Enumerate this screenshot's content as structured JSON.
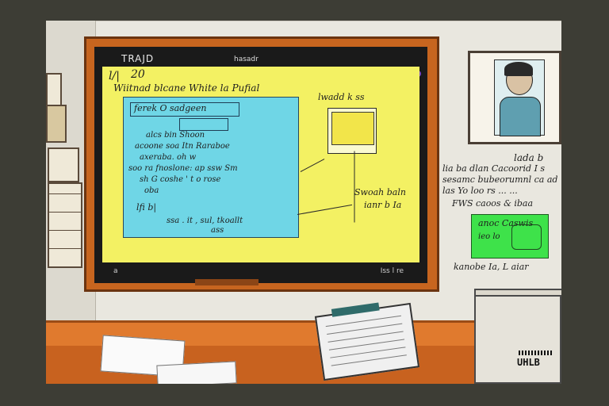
{
  "monitor": {
    "brand": "TRAJD",
    "brand_sub": "hasadr",
    "screen_heading": "Wiitnad  blcane    White  la  Pufial",
    "top_left_mark": "l/|",
    "top_left_mark2": "20",
    "blue_panel": {
      "title": "ferek  O  sadgeen",
      "lines": [
        "alcs   bin  Shoon",
        "acoone   soa  Itn  Raraboe",
        "axeraba.  oh  w",
        "soo  ra fnoslone:  ap  ssw  Sm",
        "sh  G   coshe  '  t  o  rose",
        "oba",
        "lfi b|",
        "ssa  .  it  ,  sul,  tkoallt",
        "ass"
      ]
    },
    "card_mini_caption": "lwadd  k  ss",
    "right_text": [
      "Swoah  baln",
      "ianr  b  Ia"
    ],
    "status_right": "Iss  l  re",
    "status_left": "a"
  },
  "right_wall": {
    "text_lines": [
      "lada  b",
      "lia  ba  dlan  Cacoorid  I  s",
      "sesamc  bubeorumnl  ca  ad",
      "las  Yo  loo  rs  ...  ..."
    ],
    "note_label": "FWS  caoos  &  ibaa",
    "green_note_title": "anoc  Caswis",
    "green_note_sub": "ieo  lo",
    "under_note": "kanobe  Ia,  L  aiar"
  },
  "logo": {
    "text": "UHLB"
  },
  "colors": {
    "screen": "#f3f163",
    "panel": "#6fd6e6",
    "desk": "#e07a2e",
    "note": "#3ee24a",
    "frame": "#c7651f"
  }
}
